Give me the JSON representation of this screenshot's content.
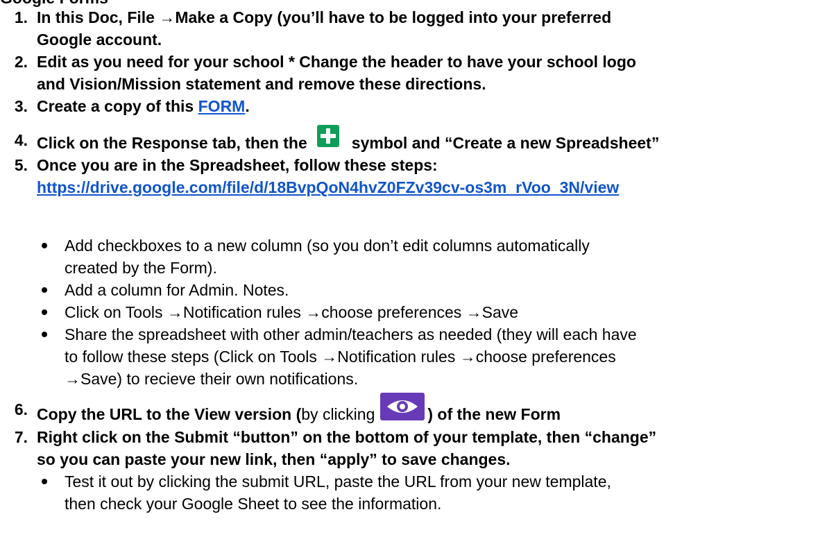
{
  "heading_partial": "Google Forms",
  "steps": [
    {
      "num": "1.",
      "line1": "In this Doc, File →Make a Copy (you’ll have to be logged into your preferred",
      "line2": "Google account."
    },
    {
      "num": "2.",
      "line1": "Edit as you need for your school * Change the header to have your school logo",
      "line2": "and Vision/Mission statement and remove these directions."
    },
    {
      "num": "3.",
      "before": "Create a copy of this ",
      "link": "FORM",
      "after": "."
    },
    {
      "num": "4.",
      "before": "Click on the Response tab, then the",
      "after": "symbol and “Create a new Spreadsheet”"
    },
    {
      "num": "5.",
      "text": "Once you are in the Spreadsheet, follow these steps:",
      "link": "https://drive.google.com/file/d/18BvpQoN4hvZ0FZv39cv-os3m_rVoo_3N/view",
      "bullets": [
        {
          "line1": "Add checkboxes to a new column (so you don’t edit columns automatically",
          "line2": "created by the Form)."
        },
        {
          "line1": "Add a column for Admin. Notes."
        },
        {
          "line1": "Click on Tools →Notification rules →choose preferences →Save"
        },
        {
          "line1": "Share the spreadsheet with other admin/teachers as needed (they will each have",
          "line2": "to follow these steps (Click on Tools →Notification rules →choose preferences",
          "line3": "→Save) to recieve their own notifications."
        }
      ]
    },
    {
      "num": "6.",
      "before": "Copy the URL to the View version (",
      "normal": "by clicking",
      "after": ") of the new Form"
    },
    {
      "num": "7.",
      "line1": "Right click on the Submit “button” on the bottom of your template, then “change”",
      "line2": "so you can paste your new link, then “apply” to save changes.",
      "bullets": [
        {
          "line1": "Test it out by clicking the submit URL, paste the URL from your new template,",
          "line2": "then check your Google Sheet to see the information."
        }
      ]
    }
  ],
  "icons": {
    "plus": "green-plus-square-icon",
    "eye": "purple-eye-icon"
  },
  "colors": {
    "link": "#1155cc",
    "plus_green": "#0f9d58",
    "eye_purple": "#673ab7"
  }
}
